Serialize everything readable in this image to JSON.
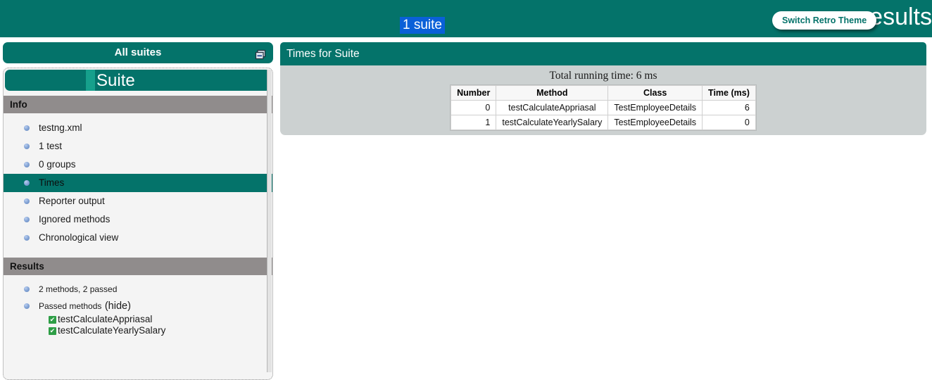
{
  "banner": {
    "suite_count": "1 suite",
    "title": "results",
    "retro_theme_button": "Switch Retro Theme",
    "bg_color": "#04736a",
    "highlight_color": "#0a60d8"
  },
  "navigator": {
    "all_suites_label": "All suites",
    "collapse_icon": "collapse-all-icon",
    "suite": {
      "name": "Suite",
      "info_header": "Info",
      "info_items": [
        {
          "label": "testng.xml",
          "selected": false
        },
        {
          "label": "1 test",
          "selected": false
        },
        {
          "label": "0 groups",
          "selected": false
        },
        {
          "label": "Times",
          "selected": true
        },
        {
          "label": "Reporter output",
          "selected": false
        },
        {
          "label": "Ignored methods",
          "selected": false
        },
        {
          "label": "Chronological view",
          "selected": false
        }
      ],
      "results_header": "Results",
      "results_summary": "2 methods, 2 passed",
      "passed_methods_label": "Passed methods",
      "hide_link": "(hide)",
      "passed_methods": [
        "testCalculateAppriasal",
        "testCalculateYearlySalary"
      ]
    }
  },
  "main": {
    "header": "Times for Suite",
    "total_running_time": "Total running time: 6 ms",
    "table": {
      "columns": [
        "Number",
        "Method",
        "Class",
        "Time (ms)"
      ],
      "rows": [
        {
          "number": "0",
          "method": "testCalculateAppriasal",
          "klass": "TestEmployeeDetails",
          "time": "6"
        },
        {
          "number": "1",
          "method": "testCalculateYearlySalary",
          "klass": "TestEmployeeDetails",
          "time": "0"
        }
      ]
    }
  }
}
